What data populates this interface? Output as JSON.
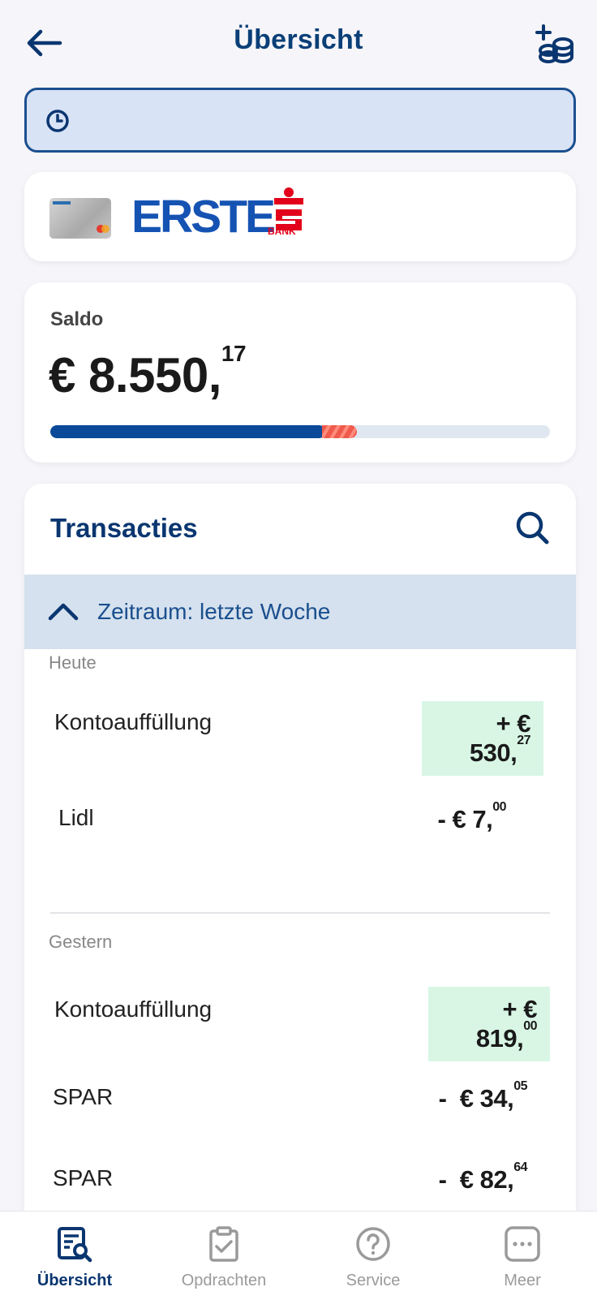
{
  "header": {
    "title": "Übersicht",
    "back_icon": "arrow-left-icon",
    "action_icon": "add-coins-icon"
  },
  "time_input": {
    "icon": "clock-icon",
    "value": ""
  },
  "bank": {
    "name": "ERSTE",
    "sub": "BANK",
    "logo_icon": "sparkasse-s-logo",
    "brand_color": "#1553b3",
    "logo_color": "#e2001a"
  },
  "balance": {
    "label": "Saldo",
    "currency": "€",
    "whole": "8.550,",
    "cents": "17",
    "used_fraction": 0.55,
    "overdraft_fraction": 0.07,
    "bar_color": "#0a4a98",
    "overdraft_color": "#ef5a4c"
  },
  "transactions": {
    "title": "Transacties",
    "search_icon": "search-icon",
    "period_label": "Zeitraum: letzte Woche",
    "groups": [
      {
        "label": "Heute",
        "items": [
          {
            "name": "Kontoauffüllung",
            "sign": "+ €",
            "whole": "530,",
            "cents": "27",
            "type": "credit"
          },
          {
            "name": "Lidl",
            "sign": "- €",
            "whole": "7,",
            "cents": "00",
            "type": "debit"
          }
        ]
      },
      {
        "label": "Gestern",
        "items": [
          {
            "name": "Kontoauffüllung",
            "sign": "+ €",
            "whole": "819,",
            "cents": "00",
            "type": "credit"
          },
          {
            "name": "SPAR",
            "sign": "-  €",
            "whole": "34,",
            "cents": "05",
            "type": "debit"
          },
          {
            "name": "SPAR",
            "sign": "-  €",
            "whole": "82,",
            "cents": "64",
            "type": "debit"
          }
        ]
      }
    ]
  },
  "nav": [
    {
      "label": "Übersicht",
      "icon": "overview-icon",
      "active": true
    },
    {
      "label": "Opdrachten",
      "icon": "clipboard-check-icon",
      "active": false
    },
    {
      "label": "Service",
      "icon": "help-circle-icon",
      "active": false
    },
    {
      "label": "Meer",
      "icon": "more-dots-icon",
      "active": false
    }
  ],
  "colors": {
    "primary": "#0a3670",
    "credit_bg": "#d9f6e5",
    "period_bg": "#d5e1ee"
  }
}
